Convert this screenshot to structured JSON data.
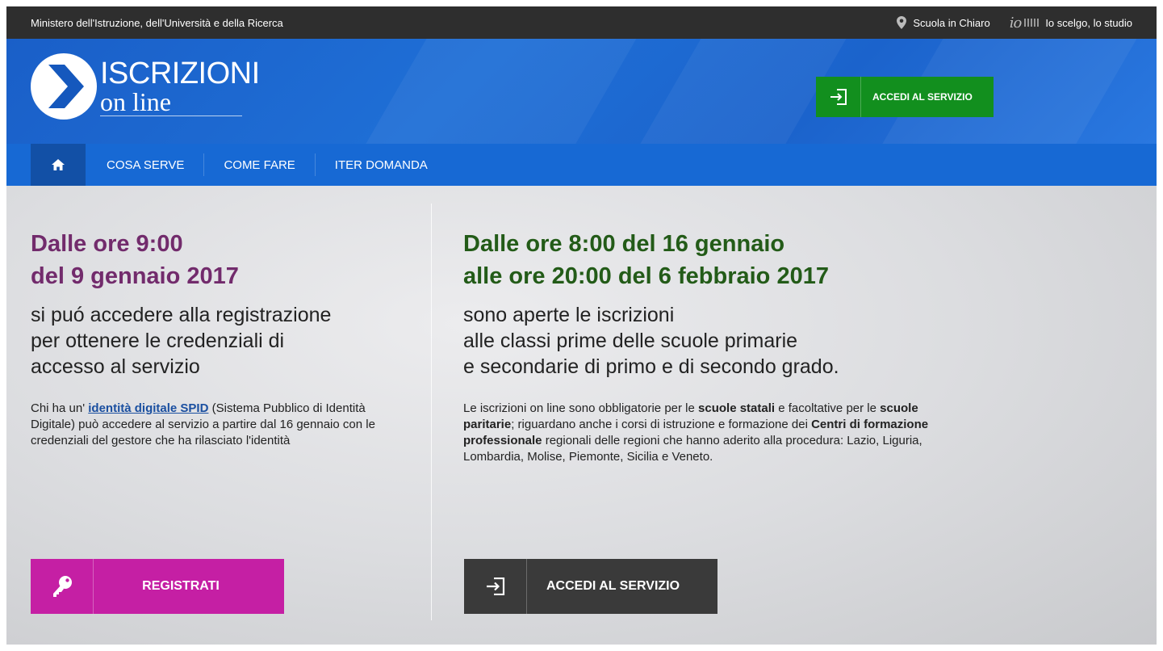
{
  "topbar": {
    "ministry": "Ministero dell'Istruzione, dell'Università e della Ricerca",
    "link_scuola": "Scuola in Chiaro",
    "link_io": "Io scelgo, lo studio"
  },
  "header": {
    "logo_title": "ISCRIZIONI",
    "logo_sub": "on line",
    "accedi_label": "ACCEDI AL SERVIZIO"
  },
  "nav": {
    "items": [
      "COSA SERVE",
      "COME FARE",
      "ITER DOMANDA"
    ]
  },
  "left": {
    "heading_line1": "Dalle ore 9:00",
    "heading_line2": "del 9 gennaio 2017",
    "lead_line1": "si puó accedere alla registrazione",
    "lead_line2": "per ottenere le credenziali di",
    "lead_line3": "accesso al servizio",
    "body_before": "Chi ha un' ",
    "body_link": "identità digitale SPID",
    "body_after": " (Sistema Pubblico di Identità Digitale) può accedere al servizio a partire dal 16 gennaio con le credenziali del gestore che ha rilasciato l'identità",
    "button_label": "REGISTRATI"
  },
  "right": {
    "heading_line1": "Dalle ore 8:00 del 16 gennaio",
    "heading_line2": "alle ore 20:00 del 6 febbraio 2017",
    "lead_line1": "sono aperte le iscrizioni",
    "lead_line2": "alle classi prime delle scuole primarie",
    "lead_line3": "e secondarie di primo e di secondo grado.",
    "body_1": "Le iscrizioni on line sono obbligatorie per le ",
    "body_b1": "scuole statali",
    "body_2": " e facoltative per le ",
    "body_b2": "scuole paritarie",
    "body_3": "; riguardano anche i corsi di istruzione e formazione dei ",
    "body_b3": "Centri di formazione professionale",
    "body_4": " regionali delle regioni che hanno aderito alla procedura: Lazio, Liguria, Lombardia, Molise, Piemonte, Sicilia e Veneto.",
    "button_label": "ACCEDI AL SERVIZIO"
  },
  "colors": {
    "topbar": "#2e2e2e",
    "header_blue": "#1f6fd6",
    "nav_blue": "#1769d4",
    "green_button": "#128f1e",
    "purple_heading": "#722b6c",
    "green_heading": "#235b18",
    "magenta_button": "#c51fa4",
    "dark_button": "#3a3a3a"
  },
  "icons": {
    "location": "map-pin-icon",
    "home": "home-icon",
    "key": "key-icon",
    "login": "login-icon",
    "logo": "chevron-right-circle-icon"
  }
}
